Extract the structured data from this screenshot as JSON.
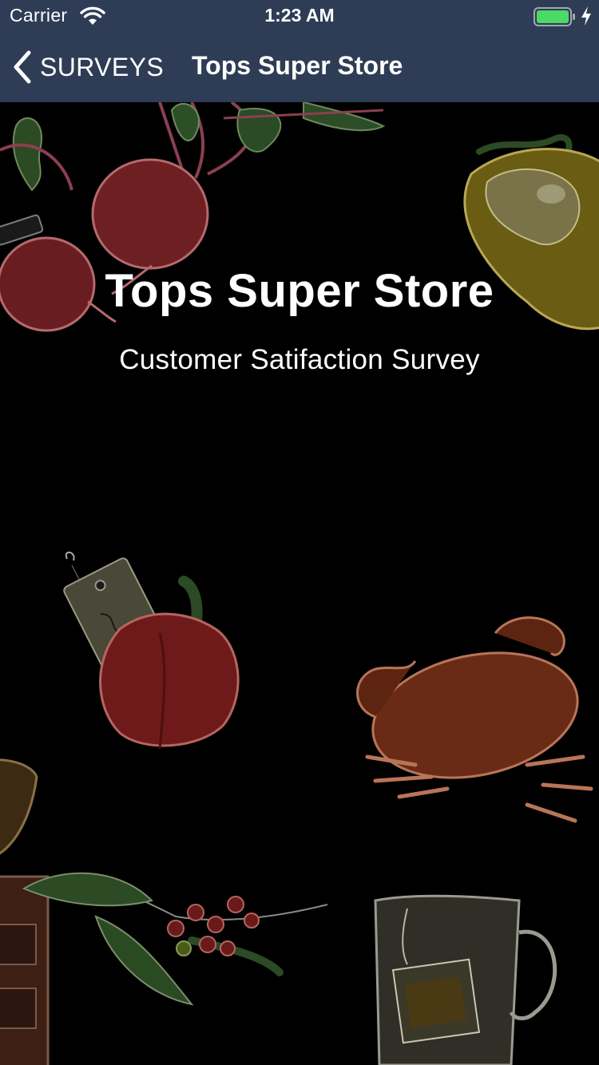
{
  "status_bar": {
    "carrier": "Carrier",
    "time": "1:23 AM",
    "battery_color": "#4cd964"
  },
  "nav": {
    "back_label": "SURVEYS",
    "title": "Tops Super Store",
    "bar_color": "#2e3d55"
  },
  "hero": {
    "title": "Tops Super Store",
    "subtitle": "Customer Satifaction Survey"
  },
  "background_illustrations": [
    "beets",
    "yellow-pepper",
    "red-pepper-with-organic-tag",
    "crab",
    "coffee-grinder",
    "coffee-branch",
    "tea-glass"
  ]
}
